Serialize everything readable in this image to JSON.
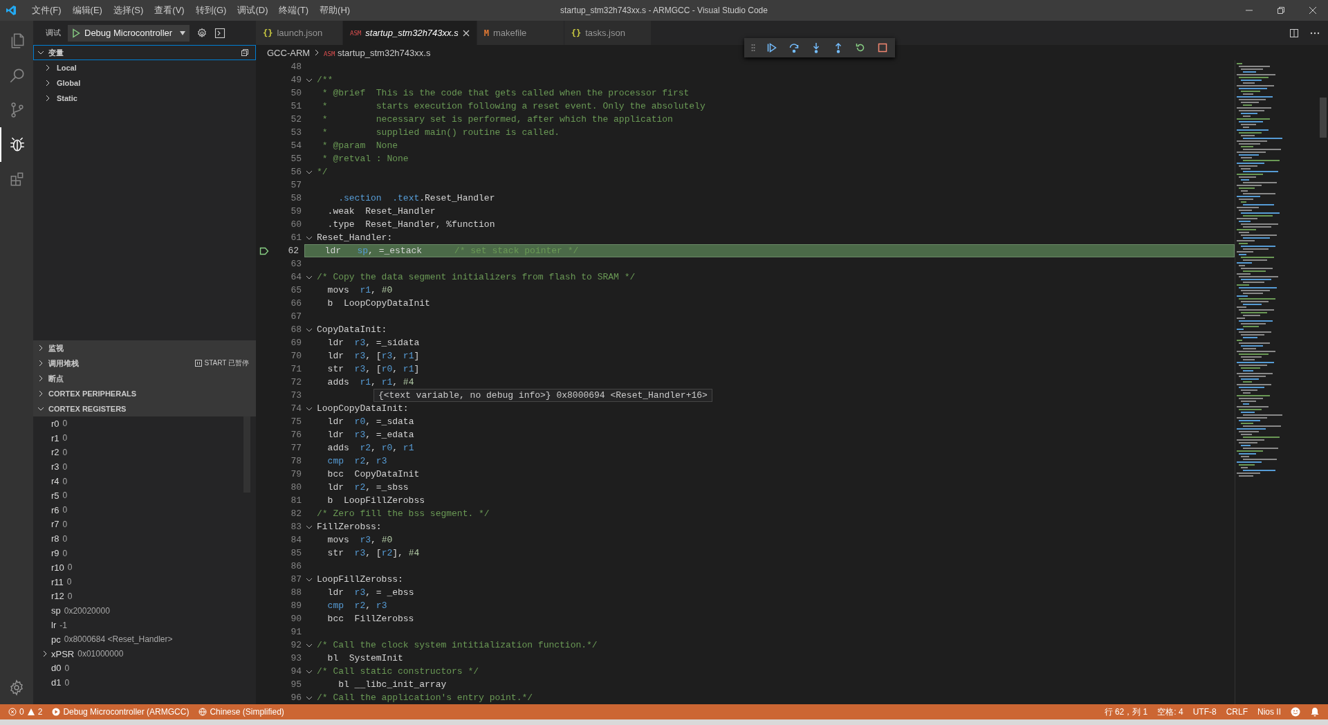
{
  "title_bar": {
    "menus": [
      "文件(F)",
      "编辑(E)",
      "选择(S)",
      "查看(V)",
      "转到(G)",
      "调试(D)",
      "终端(T)",
      "帮助(H)"
    ],
    "title": "startup_stm32h743xx.s - ARMGCC - Visual Studio Code"
  },
  "activity_bar": {
    "items": [
      {
        "kind": "explorer",
        "selected": false
      },
      {
        "kind": "search",
        "selected": false
      },
      {
        "kind": "scm",
        "selected": false
      },
      {
        "kind": "debug",
        "selected": true
      },
      {
        "kind": "extensions",
        "selected": false
      }
    ]
  },
  "sidebar": {
    "debug_label": "调试",
    "configuration": "Debug Microcontroller",
    "variables": {
      "title": "变量",
      "expanded": true,
      "scopes": [
        {
          "label": "Local",
          "expanded": false
        },
        {
          "label": "Global",
          "expanded": false
        },
        {
          "label": "Static",
          "expanded": false
        }
      ]
    },
    "sections": [
      {
        "title": "监视",
        "expanded": false
      },
      {
        "title": "调用堆栈",
        "expanded": false,
        "status": "START 已暂停"
      },
      {
        "title": "断点",
        "expanded": false
      },
      {
        "title": "CORTEX PERIPHERALS",
        "expanded": false
      }
    ],
    "registers": {
      "title": "CORTEX REGISTERS",
      "expanded": true,
      "items": [
        {
          "name": "r0",
          "value": "0"
        },
        {
          "name": "r1",
          "value": "0"
        },
        {
          "name": "r2",
          "value": "0"
        },
        {
          "name": "r3",
          "value": "0"
        },
        {
          "name": "r4",
          "value": "0"
        },
        {
          "name": "r5",
          "value": "0"
        },
        {
          "name": "r6",
          "value": "0"
        },
        {
          "name": "r7",
          "value": "0"
        },
        {
          "name": "r8",
          "value": "0"
        },
        {
          "name": "r9",
          "value": "0"
        },
        {
          "name": "r10",
          "value": "0"
        },
        {
          "name": "r11",
          "value": "0"
        },
        {
          "name": "r12",
          "value": "0"
        },
        {
          "name": "sp",
          "value": "0x20020000"
        },
        {
          "name": "lr",
          "value": "-1"
        },
        {
          "name": "pc",
          "value": "0x8000684 <Reset_Handler>"
        },
        {
          "name": "xPSR",
          "value": "0x01000000",
          "expandable": true
        },
        {
          "name": "d0",
          "value": "0"
        },
        {
          "name": "d1",
          "value": "0"
        }
      ]
    }
  },
  "editor": {
    "tabs": [
      {
        "kind": "json",
        "badge": "{}",
        "label": "launch.json",
        "selected": false
      },
      {
        "kind": "asm",
        "badge": "ASM",
        "label": "startup_stm32h743xx.s",
        "selected": true
      },
      {
        "kind": "make",
        "badge": "M",
        "label": "makefile",
        "selected": false
      },
      {
        "kind": "json",
        "badge": "{}",
        "label": "tasks.json",
        "selected": false
      }
    ],
    "breadcrumb": {
      "folder": "GCC-ARM",
      "badge": "ASM",
      "file": "startup_stm32h743xx.s"
    },
    "lines": [
      {
        "n": "48"
      },
      {
        "n": "49",
        "fold": true,
        "tokens": [
          {
            "text": "/**",
            "kind": "comment"
          }
        ]
      },
      {
        "n": "50",
        "tokens": [
          {
            "text": " * @brief  This is the code that gets called when the processor first",
            "kind": "comment"
          }
        ]
      },
      {
        "n": "51",
        "tokens": [
          {
            "text": " *         starts execution following a reset event. Only the absolutely",
            "kind": "comment"
          }
        ]
      },
      {
        "n": "52",
        "tokens": [
          {
            "text": " *         necessary set is performed, after which the application",
            "kind": "comment"
          }
        ]
      },
      {
        "n": "53",
        "tokens": [
          {
            "text": " *         supplied main() routine is called.",
            "kind": "comment"
          }
        ]
      },
      {
        "n": "54",
        "tokens": [
          {
            "text": " * @param  None",
            "kind": "comment"
          }
        ]
      },
      {
        "n": "55",
        "tokens": [
          {
            "text": " * @retval : None",
            "kind": "comment"
          }
        ]
      },
      {
        "n": "56",
        "fold": true,
        "tokens": [
          {
            "text": "*/",
            "kind": "comment"
          }
        ]
      },
      {
        "n": "57"
      },
      {
        "n": "58",
        "tokens": [
          {
            "text": "    .section",
            "kind": "keyword"
          },
          {
            "text": "  .text",
            "kind": "keyword"
          },
          {
            "text": ".Reset_Handler",
            "kind": "plain"
          }
        ]
      },
      {
        "n": "59",
        "tokens": [
          {
            "text": "  .weak  Reset_Handler",
            "kind": "plain"
          }
        ]
      },
      {
        "n": "60",
        "tokens": [
          {
            "text": "  .type  Reset_Handler, %function",
            "kind": "plain"
          }
        ]
      },
      {
        "n": "61",
        "fold": true,
        "tokens": [
          {
            "text": "Reset_Handler:",
            "kind": "plain"
          }
        ]
      },
      {
        "n": "62",
        "current": true,
        "tokens": [
          {
            "text": "  ldr   ",
            "kind": "plain"
          },
          {
            "text": "sp",
            "kind": "keyword"
          },
          {
            "text": ", =_estack      ",
            "kind": "plain"
          },
          {
            "text": "/* set stack pointer */",
            "kind": "comment"
          }
        ]
      },
      {
        "n": "63"
      },
      {
        "n": "64",
        "fold": true,
        "tokens": [
          {
            "text": "/* Copy the data segment initializers from flash to SRAM */",
            "kind": "comment"
          }
        ]
      },
      {
        "n": "65",
        "tokens": [
          {
            "text": "  movs  ",
            "kind": "plain"
          },
          {
            "text": "r1",
            "kind": "keyword"
          },
          {
            "text": ", ",
            "kind": "plain"
          },
          {
            "text": "#0",
            "kind": "number"
          }
        ]
      },
      {
        "n": "66",
        "tokens": [
          {
            "text": "  b  LoopCopyDataInit",
            "kind": "plain"
          }
        ]
      },
      {
        "n": "67"
      },
      {
        "n": "68",
        "fold": true,
        "tokens": [
          {
            "text": "CopyDataInit:",
            "kind": "plain"
          }
        ]
      },
      {
        "n": "69",
        "tokens": [
          {
            "text": "  ldr  ",
            "kind": "plain"
          },
          {
            "text": "r3",
            "kind": "keyword"
          },
          {
            "text": ", =_sidata",
            "kind": "plain"
          }
        ]
      },
      {
        "n": "70",
        "tokens": [
          {
            "text": "  ldr  ",
            "kind": "plain"
          },
          {
            "text": "r3",
            "kind": "keyword"
          },
          {
            "text": ", [",
            "kind": "plain"
          },
          {
            "text": "r3",
            "kind": "keyword"
          },
          {
            "text": ", ",
            "kind": "plain"
          },
          {
            "text": "r1",
            "kind": "keyword"
          },
          {
            "text": "]",
            "kind": "plain"
          }
        ]
      },
      {
        "n": "71",
        "tokens": [
          {
            "text": "  str  ",
            "kind": "plain"
          },
          {
            "text": "r3",
            "kind": "keyword"
          },
          {
            "text": ", [",
            "kind": "plain"
          },
          {
            "text": "r0",
            "kind": "keyword"
          },
          {
            "text": ", ",
            "kind": "plain"
          },
          {
            "text": "r1",
            "kind": "keyword"
          },
          {
            "text": "]",
            "kind": "plain"
          }
        ]
      },
      {
        "n": "72",
        "tokens": [
          {
            "text": "  adds  ",
            "kind": "plain"
          },
          {
            "text": "r1",
            "kind": "keyword"
          },
          {
            "text": ", ",
            "kind": "plain"
          },
          {
            "text": "r1",
            "kind": "keyword"
          },
          {
            "text": ", ",
            "kind": "plain"
          },
          {
            "text": "#4",
            "kind": "number"
          }
        ]
      },
      {
        "n": "73"
      },
      {
        "n": "74",
        "fold": true,
        "tokens": [
          {
            "text": "LoopCopyDataInit:",
            "kind": "plain"
          }
        ]
      },
      {
        "n": "75",
        "tokens": [
          {
            "text": "  ldr  ",
            "kind": "plain"
          },
          {
            "text": "r0",
            "kind": "keyword"
          },
          {
            "text": ", =_sdata",
            "kind": "plain"
          }
        ]
      },
      {
        "n": "76",
        "tokens": [
          {
            "text": "  ldr  ",
            "kind": "plain"
          },
          {
            "text": "r3",
            "kind": "keyword"
          },
          {
            "text": ", =_edata",
            "kind": "plain"
          }
        ]
      },
      {
        "n": "77",
        "tokens": [
          {
            "text": "  adds  ",
            "kind": "plain"
          },
          {
            "text": "r2",
            "kind": "keyword"
          },
          {
            "text": ", ",
            "kind": "plain"
          },
          {
            "text": "r0",
            "kind": "keyword"
          },
          {
            "text": ", ",
            "kind": "plain"
          },
          {
            "text": "r1",
            "kind": "keyword"
          }
        ]
      },
      {
        "n": "78",
        "tokens": [
          {
            "text": "  cmp",
            "kind": "keyword"
          },
          {
            "text": "  r2",
            "kind": "keyword"
          },
          {
            "text": ", ",
            "kind": "plain"
          },
          {
            "text": "r3",
            "kind": "keyword"
          }
        ]
      },
      {
        "n": "79",
        "tokens": [
          {
            "text": "  bcc  CopyDataInit",
            "kind": "plain"
          }
        ]
      },
      {
        "n": "80",
        "tokens": [
          {
            "text": "  ldr  ",
            "kind": "plain"
          },
          {
            "text": "r2",
            "kind": "keyword"
          },
          {
            "text": ", =_sbss",
            "kind": "plain"
          }
        ]
      },
      {
        "n": "81",
        "tokens": [
          {
            "text": "  b  LoopFillZerobss",
            "kind": "plain"
          }
        ]
      },
      {
        "n": "82",
        "tokens": [
          {
            "text": "/* Zero fill the bss segment. */",
            "kind": "comment"
          }
        ]
      },
      {
        "n": "83",
        "fold": true,
        "tokens": [
          {
            "text": "FillZerobss:",
            "kind": "plain"
          }
        ]
      },
      {
        "n": "84",
        "tokens": [
          {
            "text": "  movs  ",
            "kind": "plain"
          },
          {
            "text": "r3",
            "kind": "keyword"
          },
          {
            "text": ", ",
            "kind": "plain"
          },
          {
            "text": "#0",
            "kind": "number"
          }
        ]
      },
      {
        "n": "85",
        "tokens": [
          {
            "text": "  str  ",
            "kind": "plain"
          },
          {
            "text": "r3",
            "kind": "keyword"
          },
          {
            "text": ", [",
            "kind": "plain"
          },
          {
            "text": "r2",
            "kind": "keyword"
          },
          {
            "text": "], ",
            "kind": "plain"
          },
          {
            "text": "#4",
            "kind": "number"
          }
        ]
      },
      {
        "n": "86"
      },
      {
        "n": "87",
        "fold": true,
        "tokens": [
          {
            "text": "LoopFillZerobss:",
            "kind": "plain"
          }
        ]
      },
      {
        "n": "88",
        "tokens": [
          {
            "text": "  ldr  ",
            "kind": "plain"
          },
          {
            "text": "r3",
            "kind": "keyword"
          },
          {
            "text": ", = _ebss",
            "kind": "plain"
          }
        ]
      },
      {
        "n": "89",
        "tokens": [
          {
            "text": "  cmp",
            "kind": "keyword"
          },
          {
            "text": "  r2",
            "kind": "keyword"
          },
          {
            "text": ", ",
            "kind": "plain"
          },
          {
            "text": "r3",
            "kind": "keyword"
          }
        ]
      },
      {
        "n": "90",
        "tokens": [
          {
            "text": "  bcc  FillZerobss",
            "kind": "plain"
          }
        ]
      },
      {
        "n": "91"
      },
      {
        "n": "92",
        "fold": true,
        "tokens": [
          {
            "text": "/* Call the clock system intitialization function.*/",
            "kind": "comment"
          }
        ]
      },
      {
        "n": "93",
        "tokens": [
          {
            "text": "  bl  SystemInit",
            "kind": "plain"
          }
        ]
      },
      {
        "n": "94",
        "fold": true,
        "tokens": [
          {
            "text": "/* Call static constructors */",
            "kind": "comment"
          }
        ]
      },
      {
        "n": "95",
        "tokens": [
          {
            "text": "    bl __libc_init_array",
            "kind": "plain"
          }
        ]
      },
      {
        "n": "96",
        "fold": true,
        "tokens": [
          {
            "text": "/* Call the application's entry point.*/",
            "kind": "comment"
          }
        ]
      }
    ],
    "hover": "{<text variable, no debug info>} 0x8000694 <Reset_Handler+16>"
  },
  "status_bar": {
    "errors": "0",
    "warnings": "2",
    "debug": "Debug Microcontroller (ARMGCC)",
    "language": "Chinese (Simplified)",
    "right": [
      "行 62，列 1",
      "空格: 4",
      "UTF-8",
      "CRLF",
      "Nios II"
    ]
  }
}
